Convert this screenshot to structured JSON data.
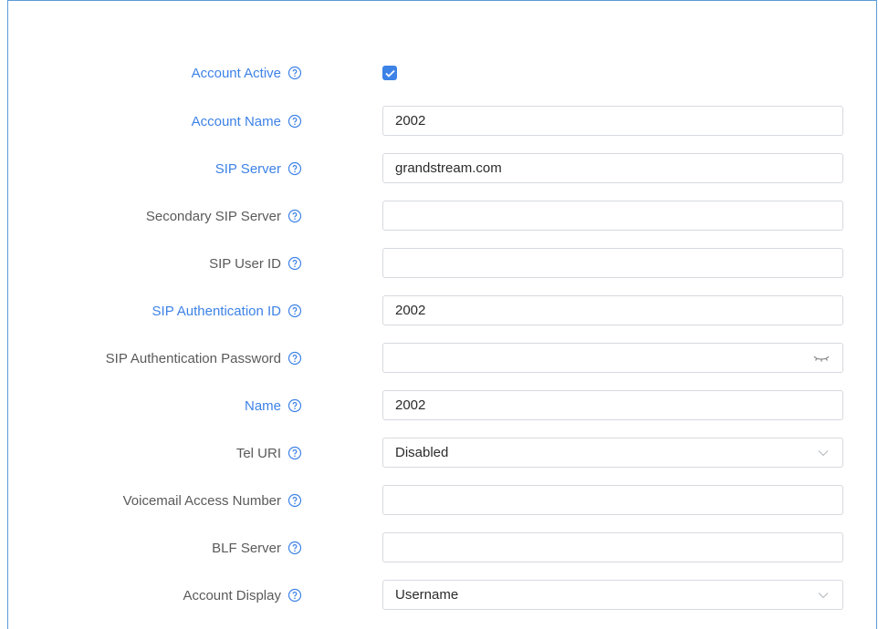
{
  "account_active": {
    "label": "Account Active",
    "checked": true
  },
  "account_name": {
    "label": "Account Name",
    "value": "2002"
  },
  "sip_server": {
    "label": "SIP Server",
    "value": "grandstream.com"
  },
  "secondary_sip_server": {
    "label": "Secondary SIP Server",
    "value": ""
  },
  "sip_user_id": {
    "label": "SIP User ID",
    "value": ""
  },
  "sip_auth_id": {
    "label": "SIP Authentication ID",
    "value": "2002"
  },
  "sip_auth_password": {
    "label": "SIP Authentication Password",
    "value": ""
  },
  "name": {
    "label": "Name",
    "value": "2002"
  },
  "tel_uri": {
    "label": "Tel URI",
    "value": "Disabled"
  },
  "voicemail_access_number": {
    "label": "Voicemail Access Number",
    "value": ""
  },
  "blf_server": {
    "label": "BLF Server",
    "value": ""
  },
  "account_display": {
    "label": "Account Display",
    "value": "Username"
  },
  "colors": {
    "accent": "#3d82e6",
    "label": "#5a5a5a",
    "border": "#d6d9de",
    "frame": "#5b9bd5"
  },
  "icons": {
    "help": "question-circle-icon",
    "dropdown": "chevron-down-icon",
    "password": "eye-closed-icon",
    "check": "checkmark-icon"
  }
}
